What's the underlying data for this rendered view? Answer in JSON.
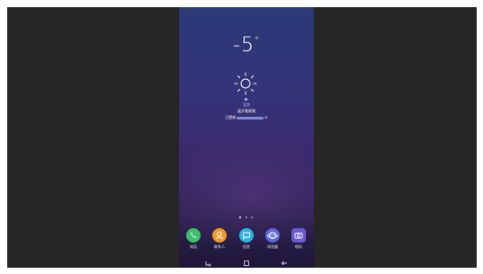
{
  "lockscreen": {
    "temperature": "-5",
    "degree_symbol": "°",
    "location": "北京",
    "line1": "展开看视频",
    "line2_prefix": "已更新",
    "line2_suffix": "⟳"
  },
  "dock": {
    "apps": [
      {
        "label": "电话",
        "icon": "phone-icon",
        "color": "#3fbf6a"
      },
      {
        "label": "联系人",
        "icon": "contacts-icon",
        "color": "#f39a2a"
      },
      {
        "label": "信息",
        "icon": "messages-icon",
        "color": "#2fb3e0"
      },
      {
        "label": "浏览器",
        "icon": "browser-icon",
        "color": "#5a6ad8"
      },
      {
        "label": "相机",
        "icon": "camera-icon",
        "color": "#6b5ad0"
      }
    ]
  },
  "navigation": {
    "recent": "recent-apps-icon",
    "home": "home-icon",
    "back": "back-icon"
  },
  "colors": {
    "viewer_background": "#262626",
    "wallpaper_top": "#2b3a78",
    "wallpaper_bottom": "#1e1738"
  }
}
